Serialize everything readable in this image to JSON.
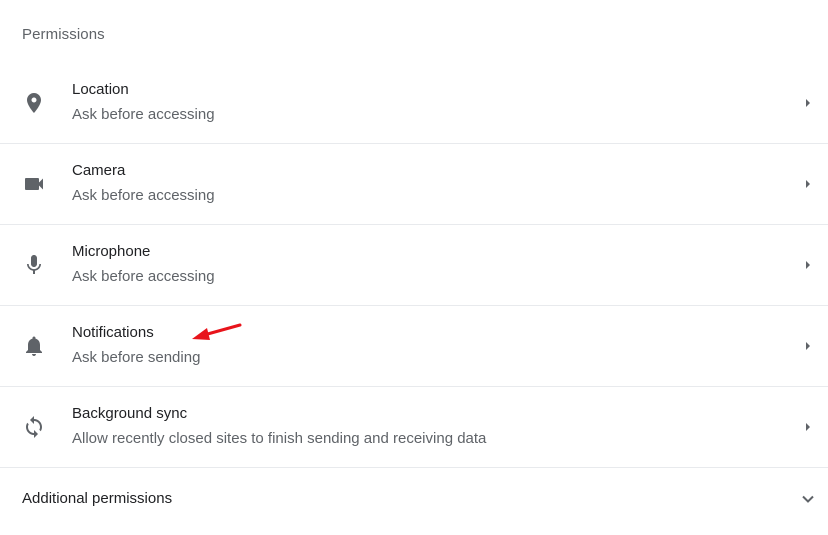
{
  "section_title": "Permissions",
  "permissions": [
    {
      "label": "Location",
      "status": "Ask before accessing",
      "icon": "location-pin-icon"
    },
    {
      "label": "Camera",
      "status": "Ask before accessing",
      "icon": "camera-icon"
    },
    {
      "label": "Microphone",
      "status": "Ask before accessing",
      "icon": "microphone-icon"
    },
    {
      "label": "Notifications",
      "status": "Ask before sending",
      "icon": "bell-icon"
    },
    {
      "label": "Background sync",
      "status": "Allow recently closed sites to finish sending and receiving data",
      "icon": "sync-icon"
    }
  ],
  "additional": {
    "label": "Additional permissions",
    "icon": "chevron-down-icon"
  },
  "colors": {
    "icon": "#5f6368",
    "text": "#202124",
    "subtext": "#5f6368",
    "divider": "#e8eaed",
    "annotation": "#e8141b"
  }
}
